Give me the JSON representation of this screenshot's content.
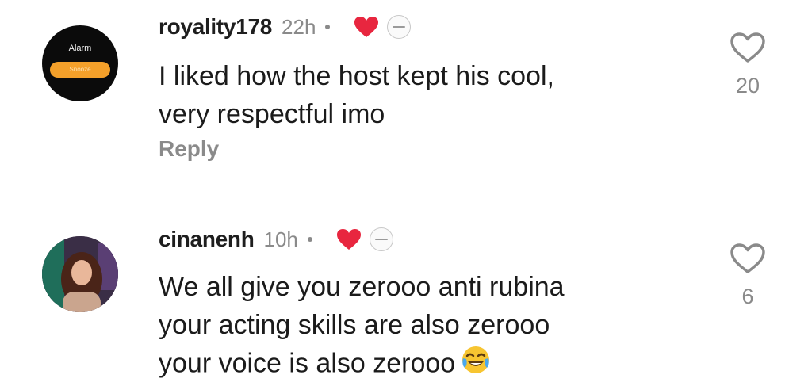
{
  "comments": [
    {
      "username": "royality178",
      "time": "22h",
      "avatar": {
        "title": "Alarm",
        "button": "Snooze"
      },
      "lines": [
        "I liked how the host kept his cool,",
        "very respectful imo"
      ],
      "reply_label": "Reply",
      "like_count": "20"
    },
    {
      "username": "cinanenh",
      "time": "10h",
      "lines": [
        "We all give you zerooo anti rubina",
        "your acting skills are also zerooo",
        "your voice is also zerooo"
      ],
      "emoji": "face-with-tears-of-joy",
      "like_count": "6"
    }
  ],
  "colors": {
    "heart": "#e8263f",
    "muted": "#8a8a8a",
    "text": "#1b1b1b"
  },
  "icons": [
    "heart-icon",
    "creator-avatar-icon",
    "like-heart-icon"
  ]
}
